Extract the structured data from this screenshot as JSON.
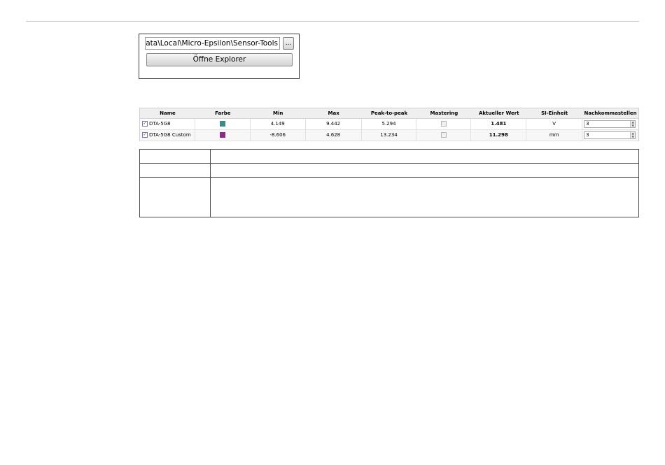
{
  "path_panel": {
    "path_value": "ppData\\Local\\Micro-Epsilon\\Sensor-Tools",
    "browse_label": "...",
    "explorer_label": "Öffne Explorer"
  },
  "signal_table": {
    "columns": [
      "Name",
      "Farbe",
      "Min",
      "Max",
      "Peak-to-peak",
      "Mastering",
      "Aktueller Wert",
      "SI-Einheit",
      "Nachkommastellen"
    ],
    "rows": [
      {
        "checked": true,
        "name": "DTA-5G8",
        "color": "#3d8a8a",
        "min": "4.149",
        "max": "9.442",
        "p2p": "5.294",
        "mastering": false,
        "current": "1.481",
        "unit": "V",
        "decimals": "3"
      },
      {
        "checked": true,
        "name": "DTA-5G8 Custom",
        "color": "#8a2a8a",
        "min": "-8.606",
        "max": "4.628",
        "p2p": "13.234",
        "mastering": false,
        "current": "11.298",
        "unit": "mm",
        "decimals": "3"
      }
    ]
  }
}
